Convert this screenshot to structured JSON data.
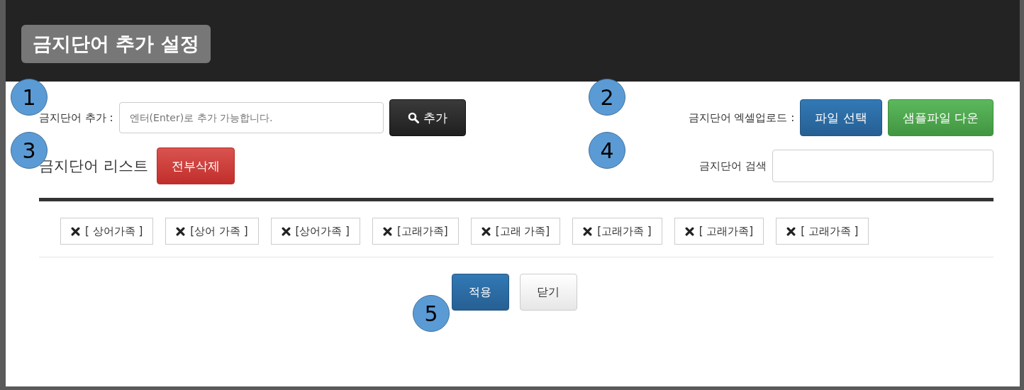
{
  "title": "금지단어 추가 설정",
  "add": {
    "label": "금지단어 추가 :",
    "placeholder": "엔터(Enter)로 추가 가능합니다.",
    "button": "추가"
  },
  "upload": {
    "label": "금지단어 엑셀업로드 :",
    "buttons": [
      {
        "label": "파일 선택",
        "kind": "primary"
      },
      {
        "label": "샘플파일 다운",
        "kind": "success"
      }
    ]
  },
  "list": {
    "heading": "금지단어 리스트",
    "delete_all": "전부삭제"
  },
  "search": {
    "label": "금지단어 검색"
  },
  "words": [
    "[ 상어가족 ]",
    "[상어 가족 ]",
    "[상어가족 ]",
    "[고래가족]",
    "[고래 가족]",
    "[고래가족 ]",
    "[ 고래가족]",
    "[ 고래가족 ]"
  ],
  "footer": {
    "buttons": [
      {
        "label": "적용",
        "kind": "primary"
      },
      {
        "label": "닫기",
        "kind": "default"
      }
    ]
  },
  "callouts": [
    "1",
    "2",
    "3",
    "4",
    "5"
  ]
}
